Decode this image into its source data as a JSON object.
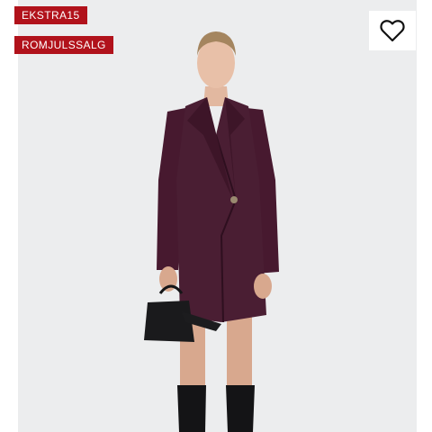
{
  "badges": [
    {
      "label": "EKSTRA15",
      "color": "#b1121b"
    },
    {
      "label": "ROMJULSSALG",
      "color": "#b1121b"
    }
  ],
  "favorite": {
    "icon": "heart-outline-icon"
  },
  "image": {
    "description_icon": "product-photo",
    "background": "#ecedee",
    "garment_color": "#4a1e33"
  }
}
